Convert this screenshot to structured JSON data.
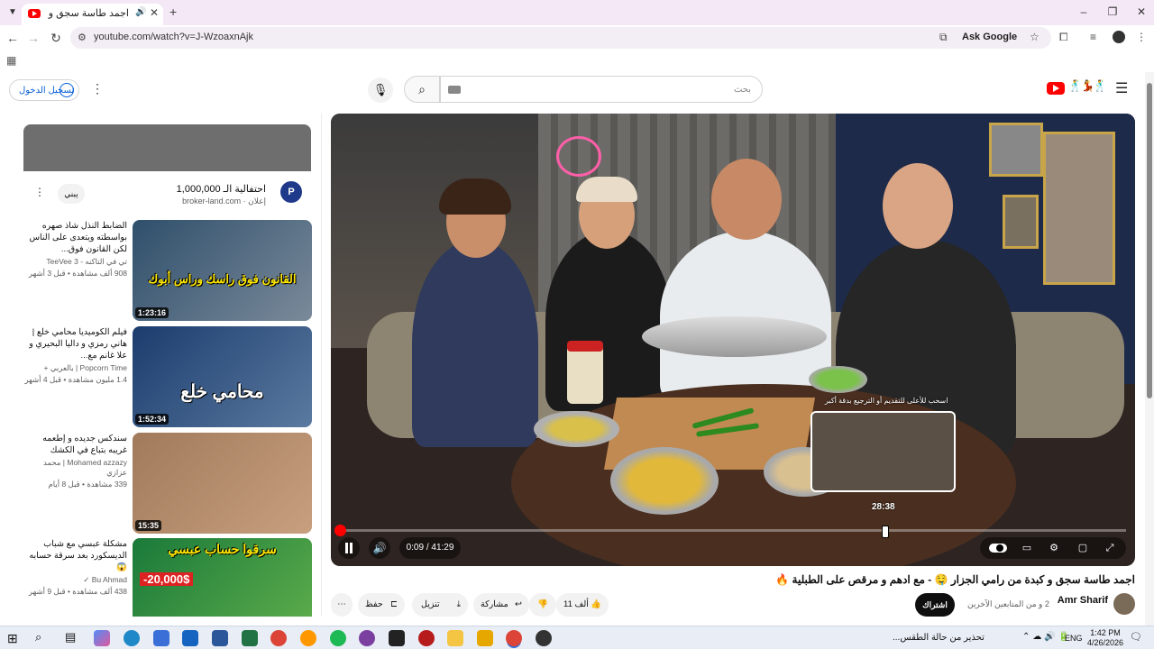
{
  "browser": {
    "tab_title": "اجمد طاسة سجق و كبدة مع",
    "url": "youtube.com/watch?v=J-WzoaxnAjk",
    "ask_google_label": "Ask Google"
  },
  "header": {
    "signin_label": "تسجيل الدخول",
    "search_placeholder": "بحث"
  },
  "ad": {
    "title": "احتفالية الـ 1,000,000",
    "domain": "إعلان · broker-land.com",
    "avatar_letter": "P",
    "button_label": "يبني"
  },
  "recommendations": [
    {
      "title": "الضابط النذل شاذ صهره بواسطته ويتعدى على الناس لكن القانون فوق...",
      "channel": "تي في التاكنه - TeeVee 3",
      "meta": "908 ألف مشاهدة • قبل 3 أشهر",
      "duration": "1:23:16",
      "thumb_text": "القانون فوق راسك وراس أبوك",
      "thumb_colors": [
        "#2f4f6b",
        "#7a8a9a"
      ]
    },
    {
      "title": "فيلم الكوميديا محامي خلع | هاني رمزي و داليا البحيري و علا غانم مع...",
      "channel": "Popcorn Time | بالعربي +",
      "meta": "1.4 مليون مشاهدة • قبل 4 أشهر",
      "duration": "1:52:34",
      "thumb_text": "محامي خلع",
      "thumb_colors": [
        "#1c3c6e",
        "#5a7aa0"
      ]
    },
    {
      "title": "سندكس جديده و إطعمه غريبه بتباع في الكشك",
      "channel": "Mohamed azzazy | محمد عزازي",
      "meta": "339 مشاهدة • قبل 8 أيام",
      "duration": "15:35",
      "thumb_text": "",
      "thumb_colors": [
        "#a07a5a",
        "#c8a080"
      ]
    },
    {
      "title": "مشكلة عبسي مع شباب الديسكورد بعد سرقة حسابه 😱",
      "channel": "Bu Ahmad ✓",
      "meta": "438 ألف مشاهدة • قبل 9 أشهر",
      "duration": "",
      "thumb_text": "سرقوا حساب عبسي",
      "thumb_sub": "20,000$-",
      "thumb_colors": [
        "#1a7a3a",
        "#5aaa4a"
      ]
    }
  ],
  "player": {
    "time": "0:09 / 41:29",
    "preview_time": "28:38",
    "preview_label": "اسحب للأعلى للتقديم أو الترجيع بدقة أكبر",
    "progress_fraction": 0.0036
  },
  "video": {
    "title": "اجمد طاسة سجق و كبدة من رامي الجزار 🤤 - مع ادهم و مرقص على الطبلية 🔥",
    "channel_name": "Amr Sharif",
    "subscribers": "2 و من المتابعين الآخرين",
    "subscribe_label": "اشتراك",
    "like_count": "11 ألف",
    "share_label": "مشاركة",
    "download_label": "تنزيل",
    "save_label": "حفظ"
  },
  "taskbar": {
    "news": "تحذير من حالة الطقس...",
    "lang": "ENG",
    "time": "1:42 PM",
    "date": "4/26/2026"
  },
  "colors": {
    "yt_red": "#ff0000",
    "link_blue": "#065fd4",
    "tab_strip": "#f4e8f7"
  }
}
